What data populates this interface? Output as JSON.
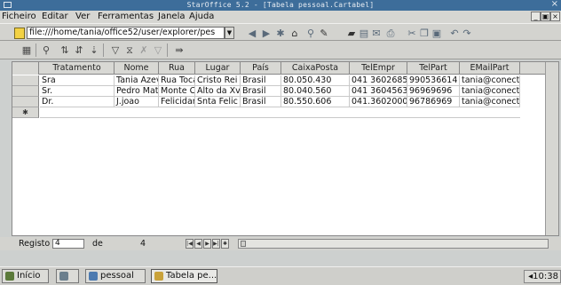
{
  "window": {
    "title": "StarOffice 5.2 - [Tabela pessoal.Cartabel]",
    "close": "×"
  },
  "menu": [
    "Ficheiro",
    "Editar",
    "Ver",
    "Ferramentas",
    "Janela",
    "Ajuda"
  ],
  "menu_controls": {
    "minimize": "_",
    "restore": "▣",
    "close": "×"
  },
  "url_bar": {
    "value": "file:///home/tania/office52/user/explorer/pes"
  },
  "grid": {
    "columns": [
      "Tratamento",
      "Nome",
      "Rua",
      "Lugar",
      "País",
      "CaixaPosta",
      "TelEmpr",
      "TelPart",
      "EMailPart"
    ],
    "rows": [
      [
        "Sra",
        "Tania Azev",
        "Rua Toca",
        "Cristo Rei",
        "Brasil",
        "80.050.430",
        "041 3602685",
        "990536614",
        "tania@conecti"
      ],
      [
        "Sr.",
        "Pedro Mat",
        "Monte C",
        "Alto da Xv",
        "Brasil",
        "80.040.560",
        "041 3604563",
        "96969696",
        "tania@conecti"
      ],
      [
        "Dr.",
        "J.joao",
        "Felicidar",
        "Snta Felic",
        "Brasil",
        "80.550.606",
        "041.3602000",
        "96786969",
        "tania@conecti"
      ]
    ]
  },
  "nav": {
    "record_label": "Registo",
    "record_value": "4",
    "of_label": "de",
    "total": "4"
  },
  "taskbar": {
    "start": "Início",
    "btn1": "pessoal",
    "btn2": "Tabela pe...",
    "clock": "10:38"
  }
}
